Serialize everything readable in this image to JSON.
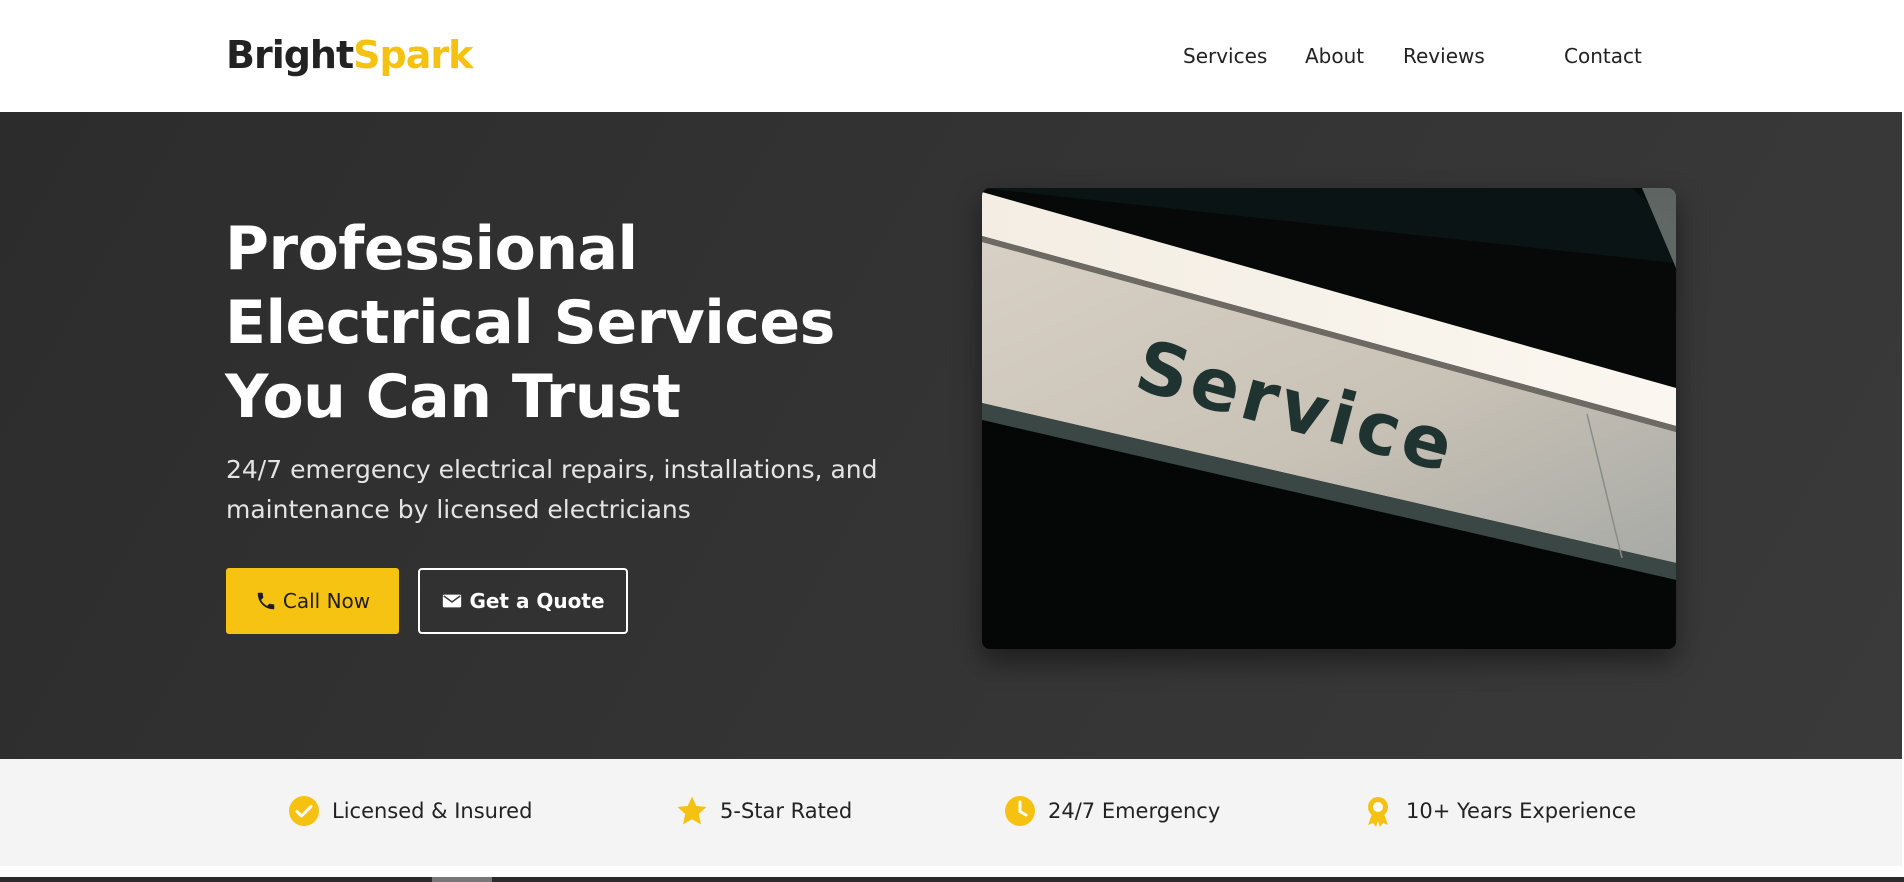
{
  "brand": {
    "name_part1": "Bright",
    "name_part2": "Spark",
    "accent_color": "#f5c211"
  },
  "nav": {
    "items": [
      {
        "label": "Services"
      },
      {
        "label": "About"
      },
      {
        "label": "Reviews"
      },
      {
        "label": "Contact"
      }
    ]
  },
  "hero": {
    "title": "Professional Electrical Services You Can Trust",
    "subtitle": "24/7 emergency electrical repairs, installations, and maintenance by licensed electricians",
    "call_button": {
      "label": "Call Now",
      "icon": "phone-icon"
    },
    "quote_button": {
      "label": "Get a Quote",
      "icon": "envelope-icon"
    },
    "image_text": "Service"
  },
  "trust": {
    "items": [
      {
        "label": "Licensed & Insured",
        "icon": "check-circle-icon"
      },
      {
        "label": "5-Star Rated",
        "icon": "star-icon"
      },
      {
        "label": "24/7 Emergency",
        "icon": "clock-icon"
      },
      {
        "label": "10+ Years Experience",
        "icon": "award-icon"
      }
    ]
  }
}
